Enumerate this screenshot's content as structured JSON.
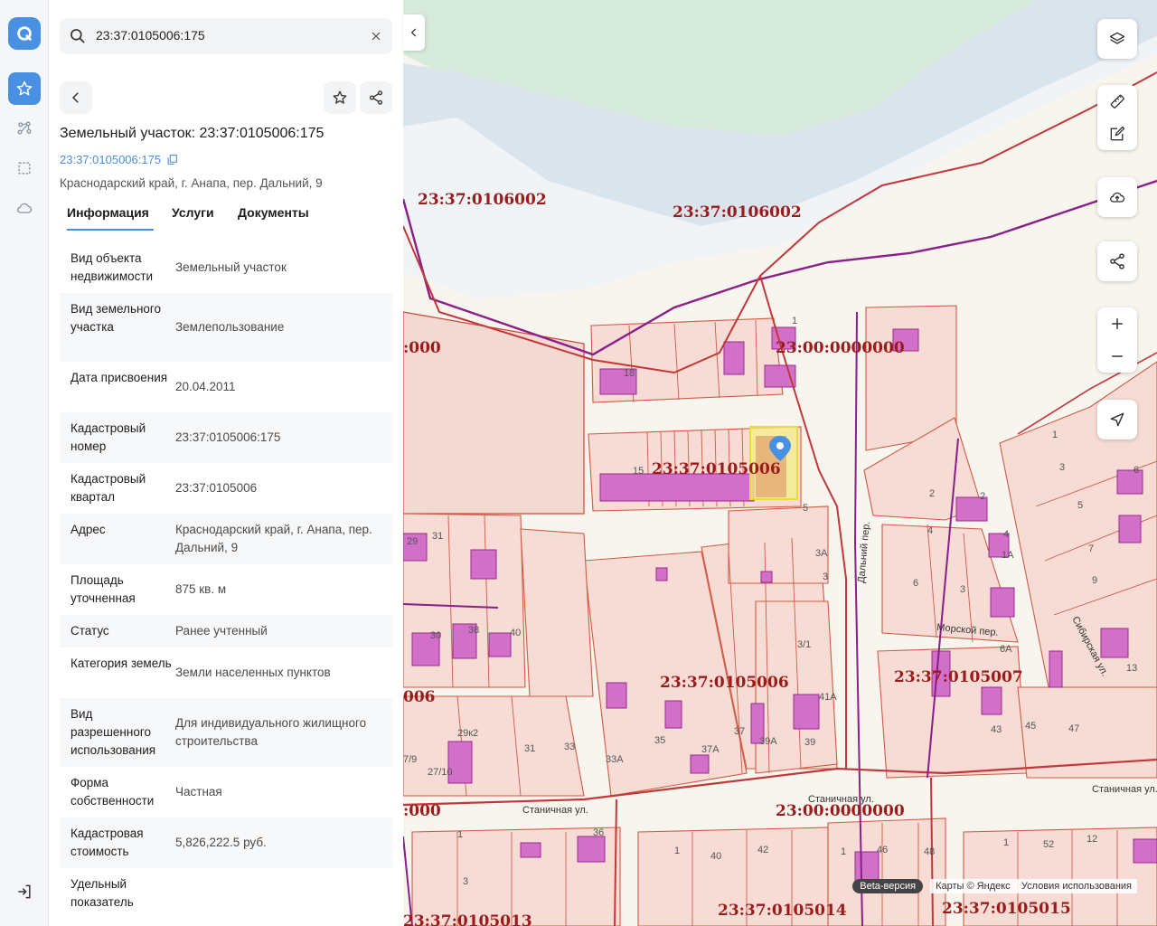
{
  "search": {
    "value": "23:37:0105006:175"
  },
  "header": {
    "title": "Земельный участок: 23:37:0105006:175",
    "cad_link": "23:37:0105006:175",
    "address": "Краснодарский край, г. Анапа, пер. Дальний, 9"
  },
  "tabs": [
    {
      "label": "Информация"
    },
    {
      "label": "Услуги"
    },
    {
      "label": "Документы"
    }
  ],
  "info_rows": [
    {
      "key": "Вид объекта недвижимости",
      "value": "Земельный участок"
    },
    {
      "key": "Вид земельного участка",
      "value": "Землепользование"
    },
    {
      "key": "Дата присвоения",
      "value": "20.04.2011"
    },
    {
      "key": "Кадастровый номер",
      "value": "23:37:0105006:175"
    },
    {
      "key": "Кадастровый квартал",
      "value": "23:37:0105006"
    },
    {
      "key": "Адрес",
      "value": "Краснодарский край, г. Анапа, пер. Дальний, 9"
    },
    {
      "key": "Площадь уточненная",
      "value": "875 кв. м"
    },
    {
      "key": "Статус",
      "value": "Ранее учтенный"
    },
    {
      "key": "Категория земель",
      "value": "Земли населенных пунктов"
    },
    {
      "key": "Вид разрешенного использования",
      "value": "Для индивидуального жилищного строительства"
    },
    {
      "key": "Форма собственности",
      "value": "Частная"
    },
    {
      "key": "Кадастровая стоимость",
      "value": "5,826,222.5 руб."
    },
    {
      "key": "Удельный показатель",
      "value": ""
    }
  ],
  "map": {
    "quarter_labels": [
      "23:37:0106002",
      "23:37:0106002",
      "23:00:0000000",
      "23:37:0105006",
      "23:37:0105006",
      "23:37:0105007",
      "23:00:0000000",
      "23:37:0105014",
      "23:37:0105015",
      "23:37:0105013",
      ":000",
      "006",
      ":000"
    ],
    "streets": [
      "Дальний пер.",
      "Морской пер.",
      "Сибирская ул.",
      "Станичная ул.",
      "Станичная ул.",
      "Станичная ул."
    ],
    "house_numbers": [
      "18",
      "15",
      "5",
      "3А",
      "3",
      "3/1",
      "41А",
      "37",
      "37А",
      "39А",
      "39",
      "35",
      "33А",
      "33",
      "31",
      "29к2",
      "27/10",
      "7/9",
      "29",
      "31",
      "38",
      "40",
      "30",
      "1",
      "3",
      "36",
      "40",
      "42",
      "1",
      "46",
      "48",
      "1",
      "52",
      "12",
      "2",
      "4",
      "6",
      "3",
      "2",
      "4",
      "1А",
      "6А",
      "43",
      "45",
      "47",
      "1",
      "3",
      "5",
      "6",
      "7",
      "9",
      "13",
      "1",
      "1"
    ],
    "footer": {
      "beta": "Beta-версия",
      "copyright": "Карты © Яндекс",
      "terms": "Условия использования"
    }
  }
}
